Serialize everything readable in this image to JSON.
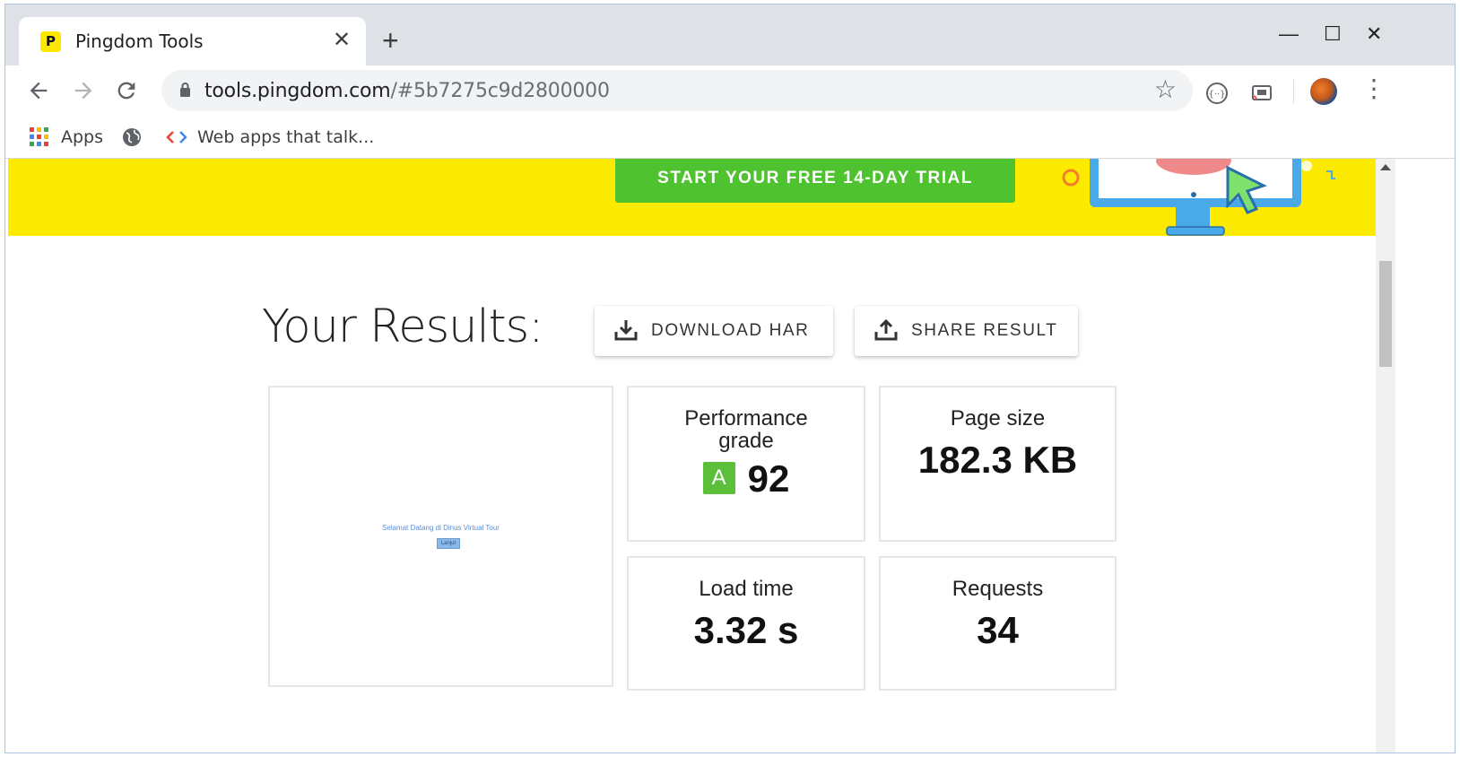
{
  "browser": {
    "tab": {
      "favicon_letter": "P",
      "title": "Pingdom Tools",
      "close": "✕"
    },
    "new_tab": "+",
    "window_controls": {
      "minimize": "—",
      "maximize": "☐",
      "close": "✕"
    },
    "url": {
      "domain": "tools.pingdom.com",
      "path": "/#5b7275c9d2800000"
    },
    "bookmarks": [
      {
        "label": "Apps"
      },
      {
        "label": "Web apps that talk..."
      }
    ]
  },
  "banner": {
    "cta_label": "START YOUR FREE 14-DAY TRIAL",
    "background": "#fcea00",
    "cta_color": "#4fc32f"
  },
  "results": {
    "title": "Your Results:",
    "download_label": "DOWNLOAD HAR",
    "share_label": "SHARE RESULT",
    "preview": {
      "text": "Selamat Datang di Dinus Virtual Tour",
      "button": "Lanjut"
    },
    "performance": {
      "label_line1": "Performance",
      "label_line2": "grade",
      "grade": "A",
      "score": "92"
    },
    "page_size": {
      "label": "Page size",
      "value": "182.3 KB"
    },
    "load_time": {
      "label": "Load time",
      "value": "3.32 s"
    },
    "requests": {
      "label": "Requests",
      "value": "34"
    }
  },
  "icons": {
    "back": "arrow-left-icon",
    "forward": "arrow-right-icon",
    "reload": "reload-icon",
    "lock": "lock-icon",
    "star": "star-icon",
    "download": "download-icon",
    "share": "upload-icon"
  }
}
